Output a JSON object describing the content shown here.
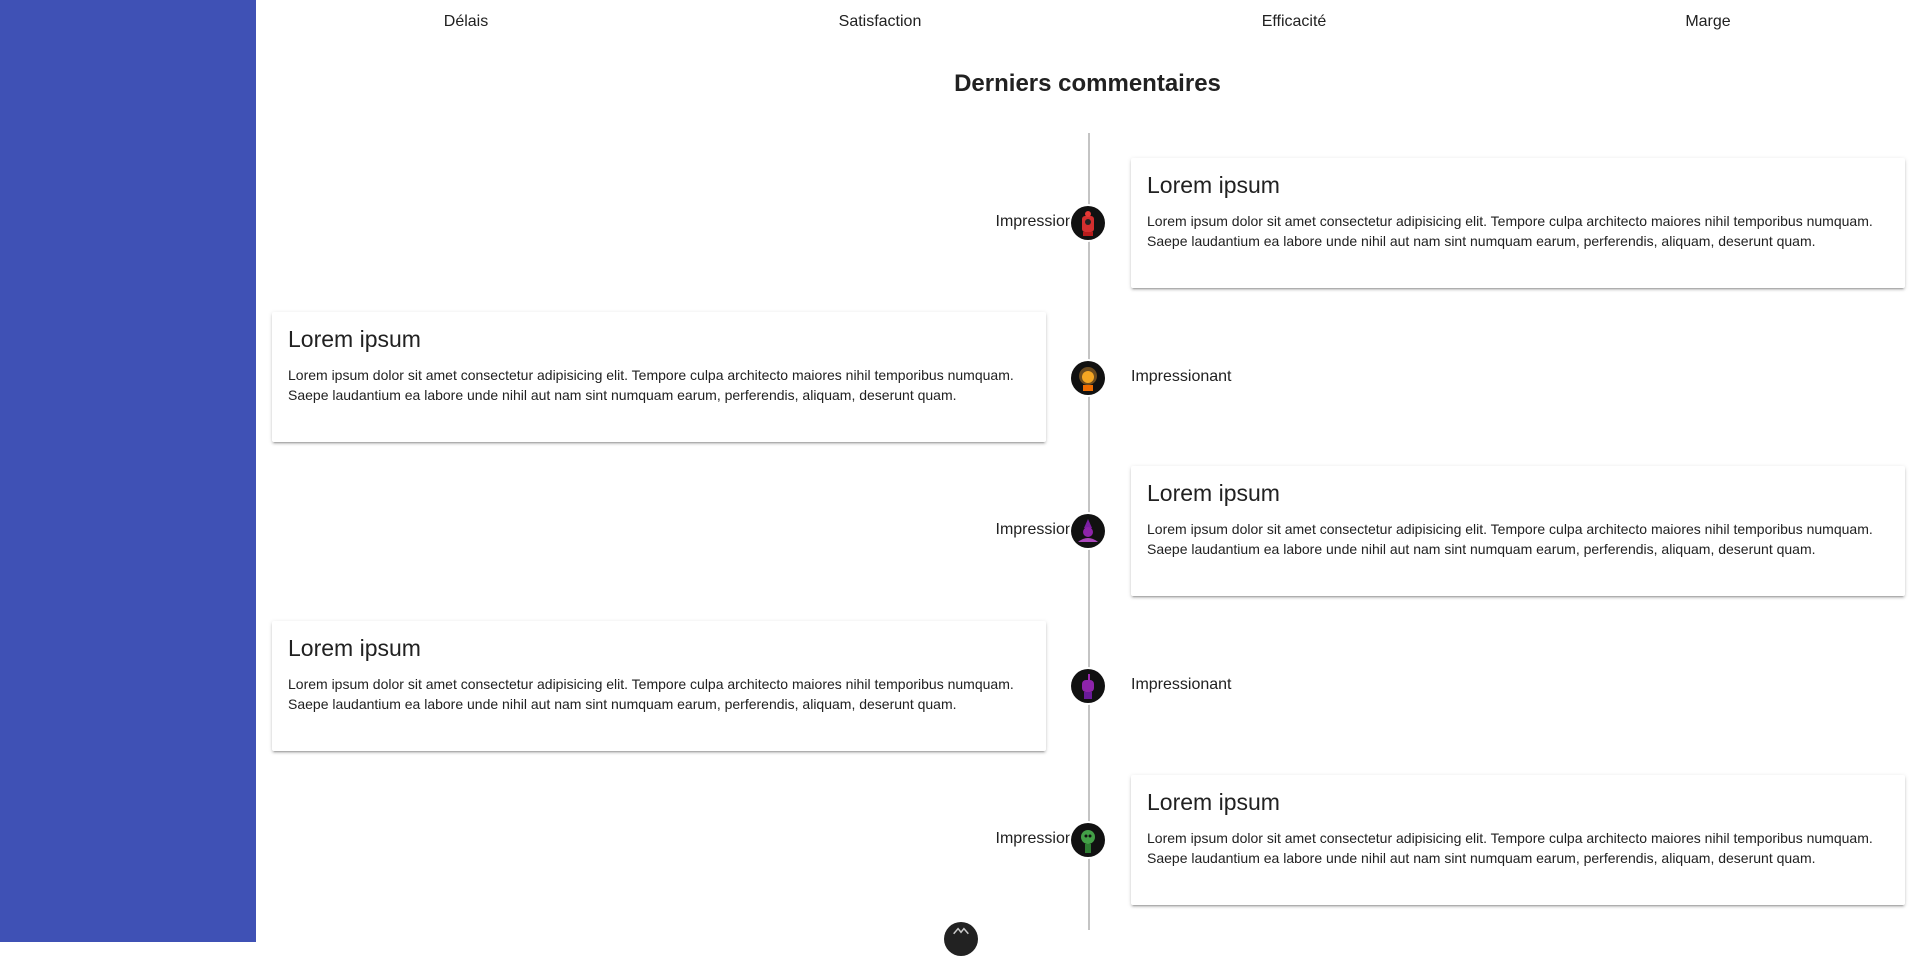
{
  "kpis": [
    {
      "label": "Délais",
      "color": "#3f51b5"
    },
    {
      "label": "Satisfaction",
      "color": "#3f51b5"
    },
    {
      "label": "Efficacité",
      "color": "#3f51b5"
    },
    {
      "label": "Marge",
      "color": "#e0e0e0"
    }
  ],
  "section_title": "Derniers commentaires",
  "comments": [
    {
      "side": "right",
      "title": "Lorem ipsum",
      "text": "Lorem ipsum dolor sit amet consectetur adipisicing elit. Tempore culpa architecto maiores nihil temporibus numquam. Saepe laudantium ea labore unde nihil aut nam sint numquam earum, perferendis, aliquam, deserunt quam.",
      "opinion": "Impressionant",
      "avatar": "red-robot-avatar"
    },
    {
      "side": "left",
      "title": "Lorem ipsum",
      "text": "Lorem ipsum dolor sit amet consectetur adipisicing elit. Tempore culpa architecto maiores nihil temporibus numquam. Saepe laudantium ea labore unde nihil aut nam sint numquam earum, perferendis, aliquam, deserunt quam.",
      "opinion": "Impressionant",
      "avatar": "woman-avatar"
    },
    {
      "side": "right",
      "title": "Lorem ipsum",
      "text": "Lorem ipsum dolor sit amet consectetur adipisicing elit. Tempore culpa architecto maiores nihil temporibus numquam. Saepe laudantium ea labore unde nihil aut nam sint numquam earum, perferendis, aliquam, deserunt quam.",
      "opinion": "Impressionant",
      "avatar": "purple-wizard-avatar"
    },
    {
      "side": "left",
      "title": "Lorem ipsum",
      "text": "Lorem ipsum dolor sit amet consectetur adipisicing elit. Tempore culpa architecto maiores nihil temporibus numquam. Saepe laudantium ea labore unde nihil aut nam sint numquam earum, perferendis, aliquam, deserunt quam.",
      "opinion": "Impressionant",
      "avatar": "purple-alien-avatar"
    },
    {
      "side": "right",
      "title": "Lorem ipsum",
      "text": "Lorem ipsum dolor sit amet consectetur adipisicing elit. Tempore culpa architecto maiores nihil temporibus numquam. Saepe laudantium ea labore unde nihil aut nam sint numquam earum, perferendis, aliquam, deserunt quam.",
      "opinion": "Impressionant",
      "avatar": "green-alien-avatar"
    }
  ],
  "colors": {
    "sidebar": "#3f51b5",
    "timeline": "#c4c4c4"
  }
}
